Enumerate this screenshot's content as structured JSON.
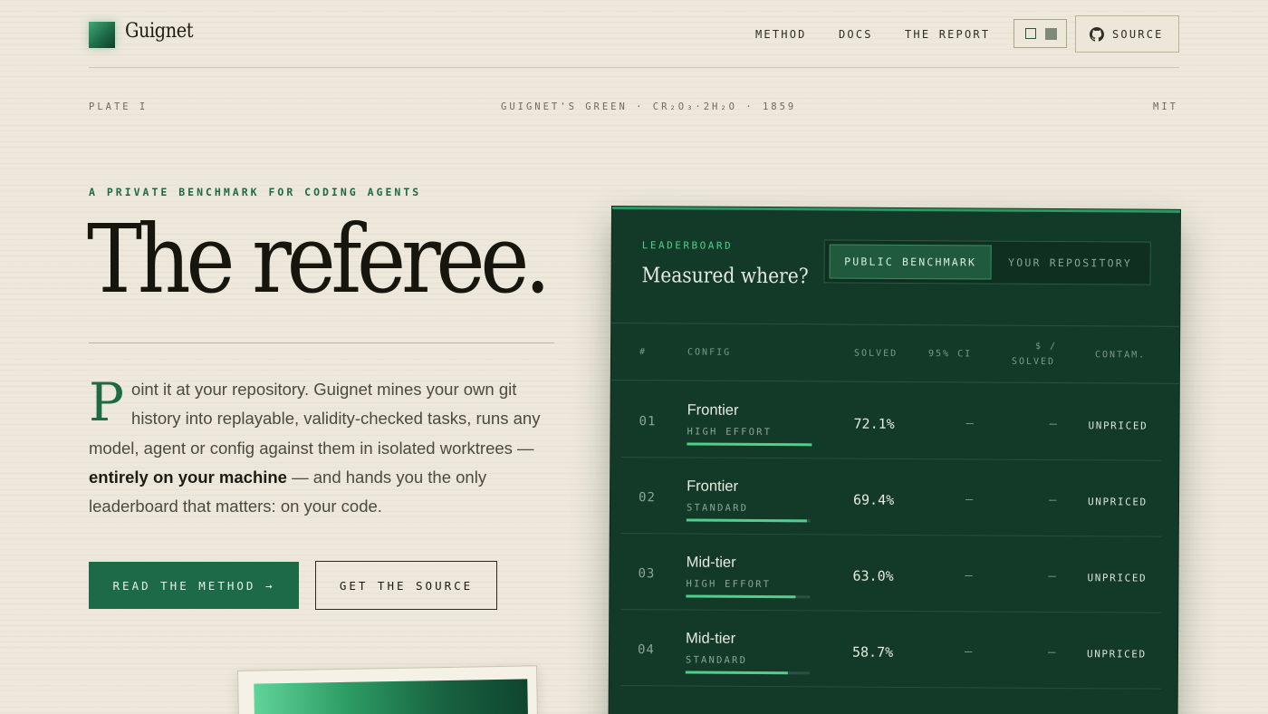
{
  "header": {
    "brand": "Guignet",
    "nav": [
      "METHOD",
      "DOCS",
      "THE REPORT"
    ],
    "source_label": "SOURCE"
  },
  "strip": {
    "left": "PLATE I",
    "center": "GUIGNET'S GREEN · CR₂O₃·2H₂O · 1859",
    "right": "MIT"
  },
  "hero": {
    "eyebrow": "A PRIVATE BENCHMARK FOR CODING AGENTS",
    "headline": "The referee.",
    "intro_dropcap": "P",
    "intro_a": "oint it at your repository. Guignet mines your own git history into replayable, validity-checked tasks, runs any model, agent or config against them in isolated worktrees — ",
    "intro_bold": "entirely on your machine",
    "intro_b": " — and hands you the only leaderboard that matters: on your code.",
    "primary_button": "READ THE METHOD →",
    "secondary_button": "GET THE SOURCE"
  },
  "leaderboard": {
    "eyebrow": "LEADERBOARD",
    "title": "Measured where?",
    "segments": [
      "PUBLIC BENCHMARK",
      "YOUR REPOSITORY"
    ],
    "columns": [
      "#",
      "CONFIG",
      "SOLVED",
      "95% CI",
      "$ /",
      "SOLVED",
      "CONTAM."
    ],
    "rows": [
      {
        "num": "01",
        "name": "Frontier",
        "effort": "HIGH EFFORT",
        "solved": "72.1%",
        "solved_value": 72.1,
        "ci": "—",
        "cost": "—",
        "contam": "UNPRICED"
      },
      {
        "num": "02",
        "name": "Frontier",
        "effort": "STANDARD",
        "solved": "69.4%",
        "solved_value": 69.4,
        "ci": "—",
        "cost": "—",
        "contam": "UNPRICED"
      },
      {
        "num": "03",
        "name": "Mid-tier",
        "effort": "HIGH EFFORT",
        "solved": "63.0%",
        "solved_value": 63.0,
        "ci": "—",
        "cost": "—",
        "contam": "UNPRICED"
      },
      {
        "num": "04",
        "name": "Mid-tier",
        "effort": "STANDARD",
        "solved": "58.7%",
        "solved_value": 58.7,
        "ci": "—",
        "cost": "—",
        "contam": "UNPRICED"
      }
    ]
  },
  "icons": {
    "logo": "logo-mark-icon",
    "theme": "theme-toggle-icon",
    "github": "github-icon"
  },
  "colors": {
    "accent": "#1d6a46",
    "panel": "#133a28",
    "highlight": "#4fcf8c"
  }
}
